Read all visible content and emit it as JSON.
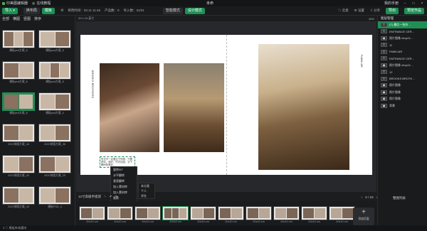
{
  "titlebar": {
    "app_name": "印美图编辑器",
    "help": "在线教程",
    "doc_title": "未命",
    "account": "我的手册",
    "minimize": "–",
    "maximize": "□",
    "close": "×"
  },
  "toolbar": {
    "import_label": "导入 ▾",
    "btn_new": "换布局",
    "btn_template": "模板",
    "info_created": "修改时间：03.11 11:46",
    "info_product": "产品数：0",
    "info_imported": "导入数：31/31",
    "tab_modes": [
      "智能模式",
      "设计模式"
    ],
    "right_btn1": "云盘",
    "right_btn2": "设置",
    "right_btn3": "分享",
    "publish": "导出",
    "publish_btn2": "预览作品"
  },
  "left_panel": {
    "filters": [
      "全部",
      "横图",
      "竖图",
      "排序"
    ],
    "thumbs": [
      {
        "label": "模板psd方案_8"
      },
      {
        "label": "模板psd方案_8"
      },
      {
        "label": "模板psd方案_8"
      },
      {
        "label": "模板psd方案_8"
      },
      {
        "label": "模板psd方案_8"
      },
      {
        "label": "模板psd方案_4"
      },
      {
        "label": "2020排版方案_44"
      },
      {
        "label": "2020排版方案_36"
      },
      {
        "label": "2020排版方案_42"
      },
      {
        "label": "2020排版方案_29"
      },
      {
        "label": "2020排版方案_43"
      },
      {
        "label": "模板PSD_4"
      }
    ],
    "bottom_label": "3 ♡ 模板库/收藏夹"
  },
  "canvas_bar": {
    "left": "20 x 10 英寸",
    "zoom": "45%"
  },
  "page_text": {
    "vertical_left": "BROOKS BROTHERS",
    "vertical_right": "FAMILIAR",
    "caption": "时光不一定要过于惊艳，只要是你，就好。时光如逝，记下瞬间的美好。"
  },
  "context_menu": {
    "items": [
      "旋转90°",
      "水平翻转",
      "垂直翻转",
      "加入素材库",
      "加入素材库",
      "替换",
      "删除"
    ],
    "submenu": [
      "本分类",
      "个人",
      "学社"
    ]
  },
  "right_panel": {
    "header": "图层管理",
    "layers": [
      {
        "label": "(T) 最后一张仿…",
        "icon": "T",
        "selected": true
      },
      {
        "label": "ENTRANCE CER…",
        "icon": "T",
        "selected": false
      },
      {
        "label": "照片图像 zhop11…",
        "icon": "▣",
        "selected": false
      },
      {
        "label": "11",
        "icon": "T",
        "selected": false
      },
      {
        "label": "FAMILIAR",
        "icon": "T",
        "selected": false
      },
      {
        "label": "ENTRANCE CER…",
        "icon": "T",
        "selected": false
      },
      {
        "label": "照片图像 zhop11…",
        "icon": "▣",
        "selected": false
      },
      {
        "label": "12",
        "icon": "T",
        "selected": false
      },
      {
        "label": "BROOKS BROTH…",
        "icon": "T",
        "selected": false
      },
      {
        "label": "照片图像",
        "icon": "▣",
        "selected": false
      },
      {
        "label": "照片图像",
        "icon": "▣",
        "selected": false
      },
      {
        "label": "照片图像",
        "icon": "▣",
        "selected": false
      },
      {
        "label": "背景",
        "icon": "▣",
        "selected": false
      }
    ]
  },
  "bottom_bar": {
    "title": "12寸高级手提袋",
    "pages": "2 / 10",
    "right_label": "整图列表"
  },
  "strip": {
    "thumbs": [
      {
        "label": "20x10 cm"
      },
      {
        "label": "20x10 cm"
      },
      {
        "label": "20x10 cm"
      },
      {
        "label": "20x10 cm"
      },
      {
        "label": "20x10 cm"
      },
      {
        "label": "20x10 cm"
      },
      {
        "label": "20x10 cm"
      },
      {
        "label": "20x10 cm"
      },
      {
        "label": "20x10 cm"
      },
      {
        "label": "20x10 cm"
      }
    ],
    "add_label": "添加页面",
    "add_icon": "+"
  },
  "footer": {
    "left": "3 ♡ 模板库/收藏夹"
  },
  "colors": {
    "accent": "#1f8f55",
    "bg": "#1c1d1f",
    "panel": "#1a1b1d"
  }
}
